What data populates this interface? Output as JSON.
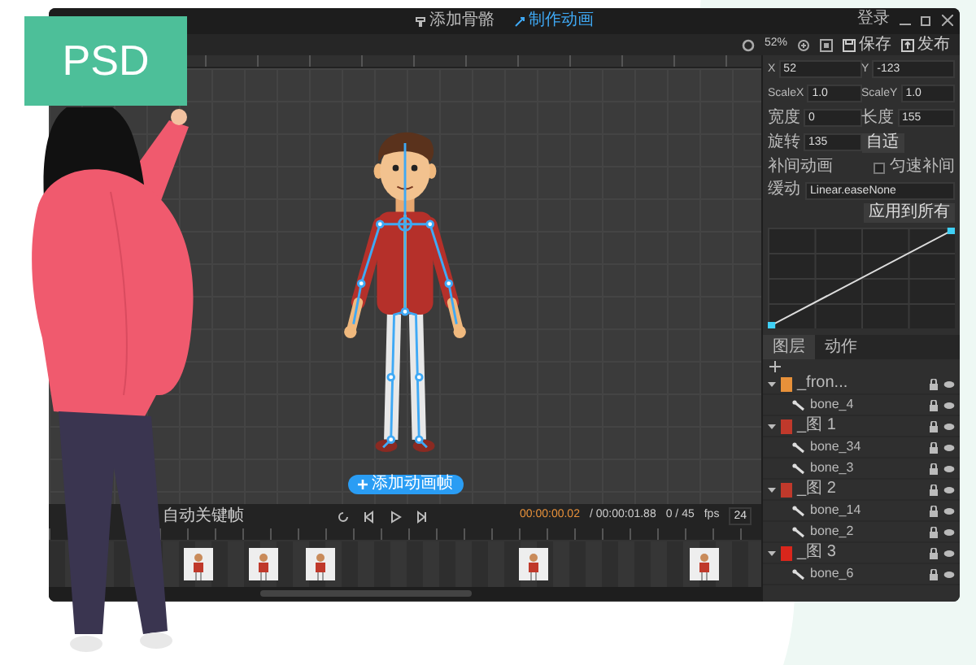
{
  "badge": "PSD",
  "title_tabs": [
    {
      "label": "添加骨骼",
      "selected": false
    },
    {
      "label": "制作动画",
      "selected": true
    }
  ],
  "account": "登录",
  "toolbar": {
    "zoom": "52%",
    "save": "保存",
    "publish": "发布"
  },
  "properties": [
    {
      "label": "X",
      "value": "52"
    },
    {
      "label": "Y",
      "value": "-123"
    },
    {
      "label": "ScaleX",
      "value": "1.0"
    },
    {
      "label": "ScaleY",
      "value": "1.0"
    },
    {
      "label": "宽度",
      "value": "0"
    },
    {
      "label": "长度",
      "value": "155"
    },
    {
      "label": "旋转",
      "value": "135"
    }
  ],
  "fit_button": "自适",
  "tween": {
    "label": "补间动画",
    "option": "匀速补间",
    "checked": false
  },
  "easing": {
    "label": "缓动",
    "value": "Linear.easeNone",
    "apply_button": "应用到所有"
  },
  "panel_tabs": [
    {
      "label": "图层",
      "selected": true
    },
    {
      "label": "动作",
      "selected": false
    }
  ],
  "layers": [
    {
      "name": "_fron...",
      "expanded": true,
      "color": "#e8913a",
      "children": [
        {
          "name": "bone_4"
        }
      ]
    },
    {
      "name": "_图 1",
      "expanded": true,
      "color": "#c0392b",
      "children": [
        {
          "name": "bone_34"
        },
        {
          "name": "bone_3"
        }
      ]
    },
    {
      "name": "_图 2",
      "expanded": true,
      "color": "#c0392b",
      "children": [
        {
          "name": "bone_14"
        },
        {
          "name": "bone_2"
        }
      ]
    },
    {
      "name": "_图 3",
      "expanded": true,
      "color": "#d9261c",
      "children": [
        {
          "name": "bone_6"
        }
      ]
    }
  ],
  "add_frame_button": "添加动画帧",
  "timeline": {
    "auto_keyframe": "自动关键帧",
    "current_time": "00:00:00.02",
    "total_time": "/ 00:00:01.88",
    "frame": "0 / 45",
    "fps_label": "fps",
    "fps": "24"
  }
}
